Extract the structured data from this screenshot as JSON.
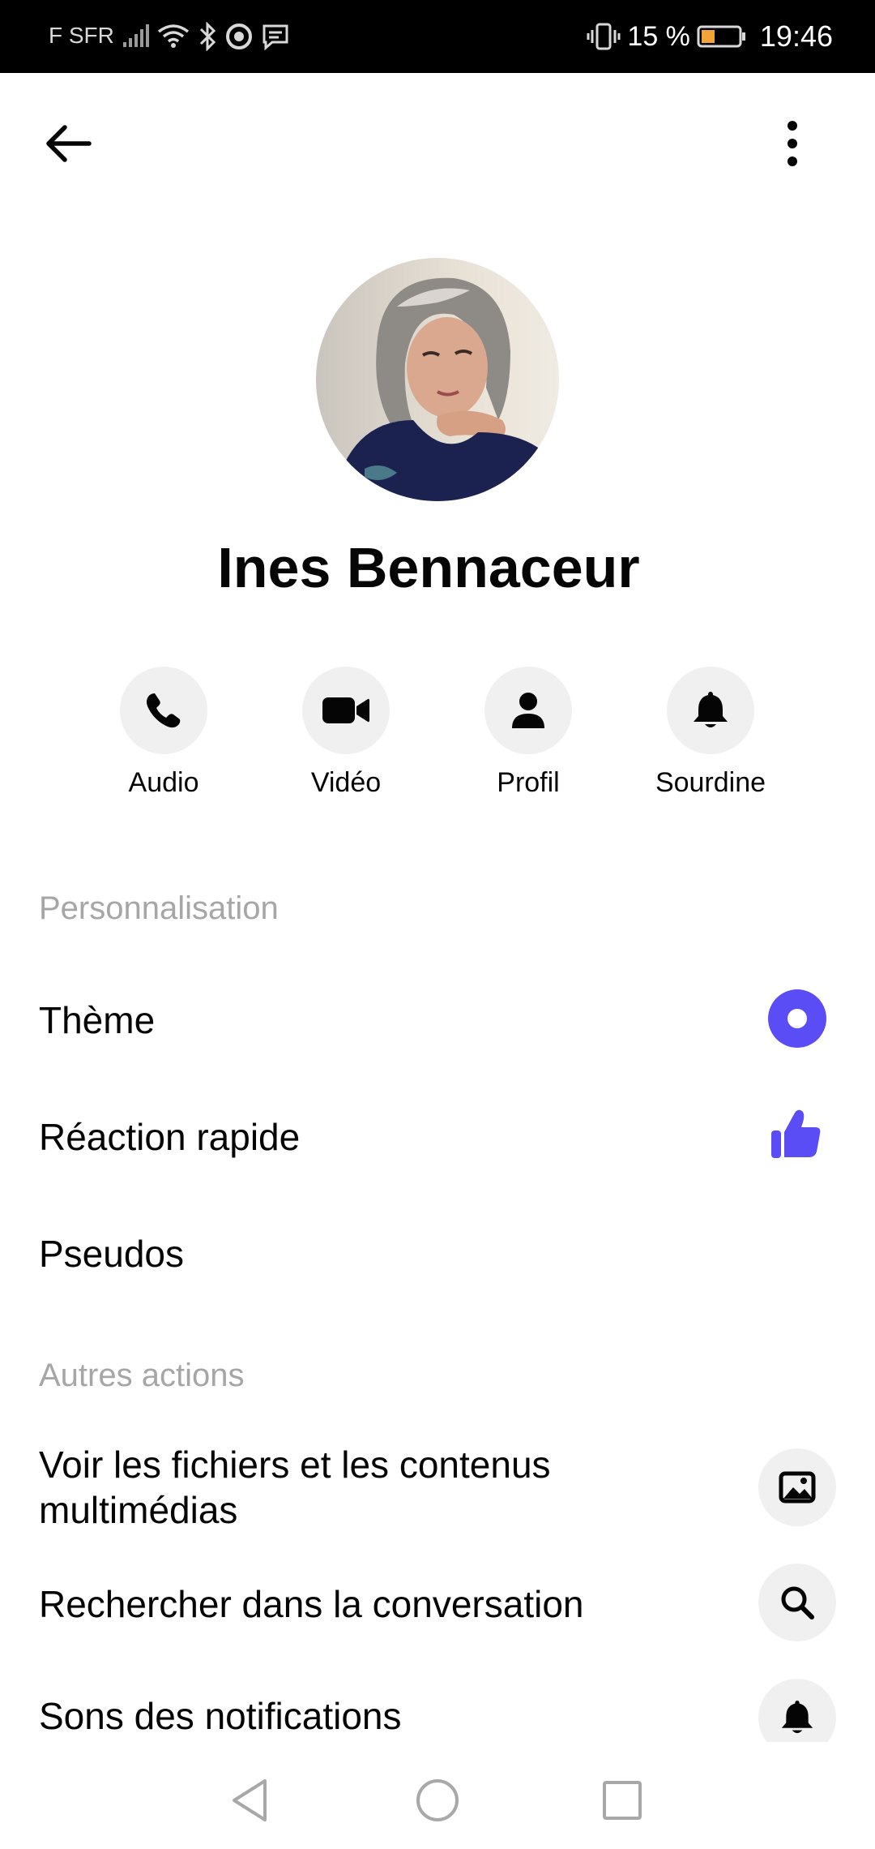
{
  "status_bar": {
    "carrier": "F SFR",
    "battery": "15 %",
    "time": "19:46"
  },
  "profile": {
    "name": "Ines Bennaceur"
  },
  "actions": [
    {
      "label": "Audio",
      "icon": "phone-icon"
    },
    {
      "label": "Vidéo",
      "icon": "video-camera-icon"
    },
    {
      "label": "Profil",
      "icon": "person-icon"
    },
    {
      "label": "Sourdine",
      "icon": "bell-icon"
    }
  ],
  "sections": {
    "personalisation": {
      "title": "Personnalisation",
      "items": [
        {
          "label": "Thème",
          "icon": "theme-color-icon"
        },
        {
          "label": "Réaction rapide",
          "icon": "thumbs-up-icon"
        },
        {
          "label": "Pseudos"
        }
      ]
    },
    "other_actions": {
      "title": "Autres actions",
      "items": [
        {
          "label": "Voir les fichiers et les contenus multimédias",
          "icon": "image-icon"
        },
        {
          "label": "Rechercher dans la conversation",
          "icon": "search-icon"
        },
        {
          "label": "Sons des notifications",
          "icon": "bell-icon"
        }
      ]
    }
  },
  "colors": {
    "accent": "#5b4df5",
    "section_title": "#a6a6a6",
    "icon_bg": "#f0f0f0"
  }
}
